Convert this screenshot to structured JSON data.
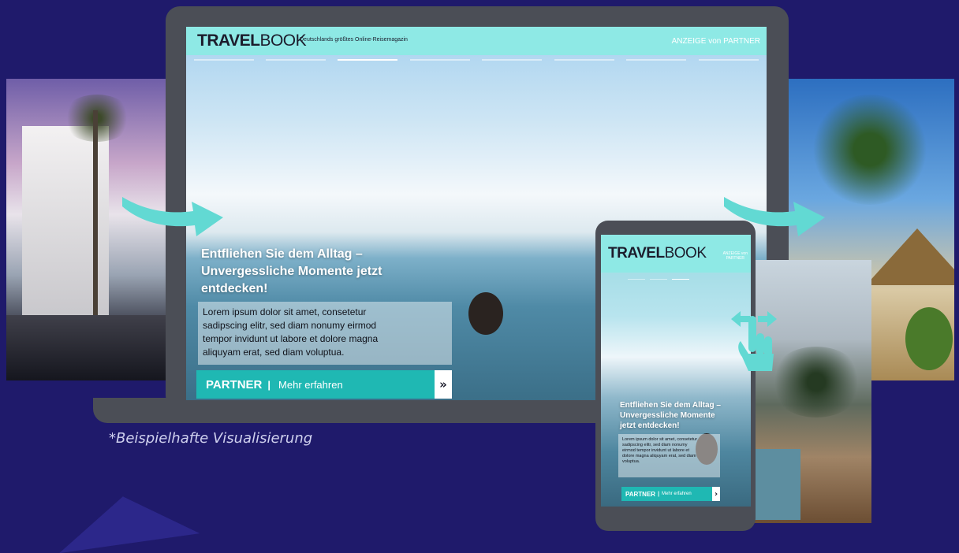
{
  "brand": {
    "logo_bold": "TRAVEL",
    "logo_light": "BOOK",
    "tagline": "Deutschlands größtes Online-Reisemagazin"
  },
  "laptop": {
    "ad_label": "ANZEIGE von PARTNER",
    "headline_lines": [
      "Entfliehen Sie dem Alltag –",
      "Unvergessliche Momente jetzt",
      "entdecken!"
    ],
    "body_lines": [
      "Lorem ipsum dolor sit amet, consetetur",
      "sadipscing elitr, sed diam nonumy eirmod",
      "tempor invidunt ut labore et dolore magna",
      "aliquyam erat, sed diam voluptua."
    ],
    "cta_partner": "PARTNER",
    "cta_sep": "|",
    "cta_text": "Mehr erfahren",
    "cta_arrow": "»"
  },
  "phone": {
    "ad_label_lines": [
      "ANZEIGE von",
      "PARTNER"
    ],
    "headline_lines": [
      "Entfliehen Sie dem Alltag –",
      "Unvergessliche Momente",
      "jetzt entdecken!"
    ],
    "body_lines": [
      "Lorem ipsum dolor sit amet, consetetur",
      "sadipscing elitr, sed diam nonumy",
      "eirmod tempor invidunt ut labore et",
      "dolore magna aliquyam erat, sed diam",
      "voluptua."
    ],
    "cta_partner": "PARTNER",
    "cta_sep": "|",
    "cta_text": "Mehr erfahren",
    "cta_arrow": "›"
  },
  "caption": "*Beispielhafte Visualisierung",
  "colors": {
    "background": "#1f1a6b",
    "device": "#4b4e56",
    "header": "#8ee9e5",
    "accent": "#1fb8b3",
    "arrow": "#62d9d3"
  },
  "icons": {
    "swipe": "swipe-gesture-icon",
    "flow_arrow": "curved-arrow-icon"
  }
}
